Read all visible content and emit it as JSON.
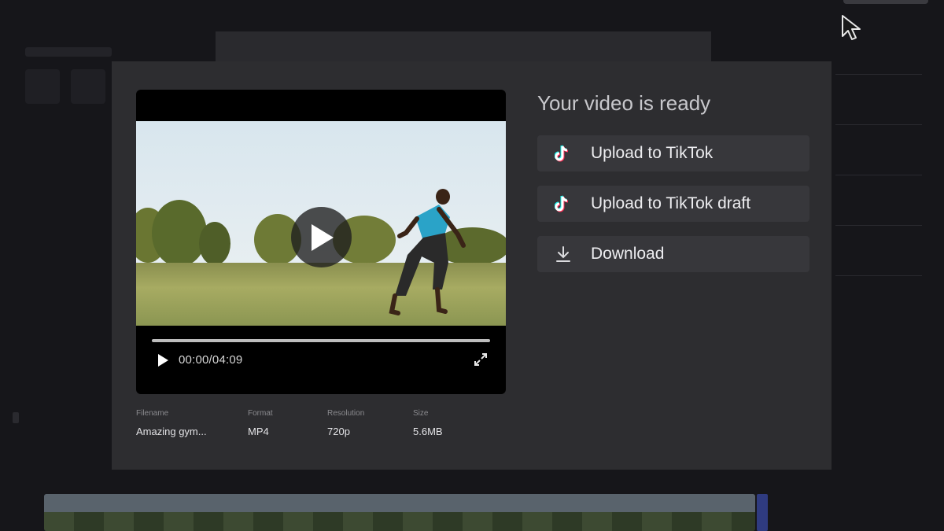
{
  "modal": {
    "title": "Your video is ready",
    "actions": [
      {
        "label": "Upload to TikTok",
        "icon": "tiktok-icon"
      },
      {
        "label": "Upload to TikTok draft",
        "icon": "tiktok-icon"
      },
      {
        "label": "Download",
        "icon": "download-icon"
      }
    ],
    "player": {
      "time": "00:00/04:09",
      "progress": 0
    },
    "meta": [
      {
        "label": "Filename",
        "value": "Amazing gym..."
      },
      {
        "label": "Format",
        "value": "MP4"
      },
      {
        "label": "Resolution",
        "value": "720p"
      },
      {
        "label": "Size",
        "value": "5.6MB"
      }
    ]
  },
  "colors": {
    "modal_bg": "#2d2d30",
    "action_bg": "#37373b",
    "tiktok_cyan": "#25f4ee",
    "tiktok_red": "#fe2c55"
  }
}
